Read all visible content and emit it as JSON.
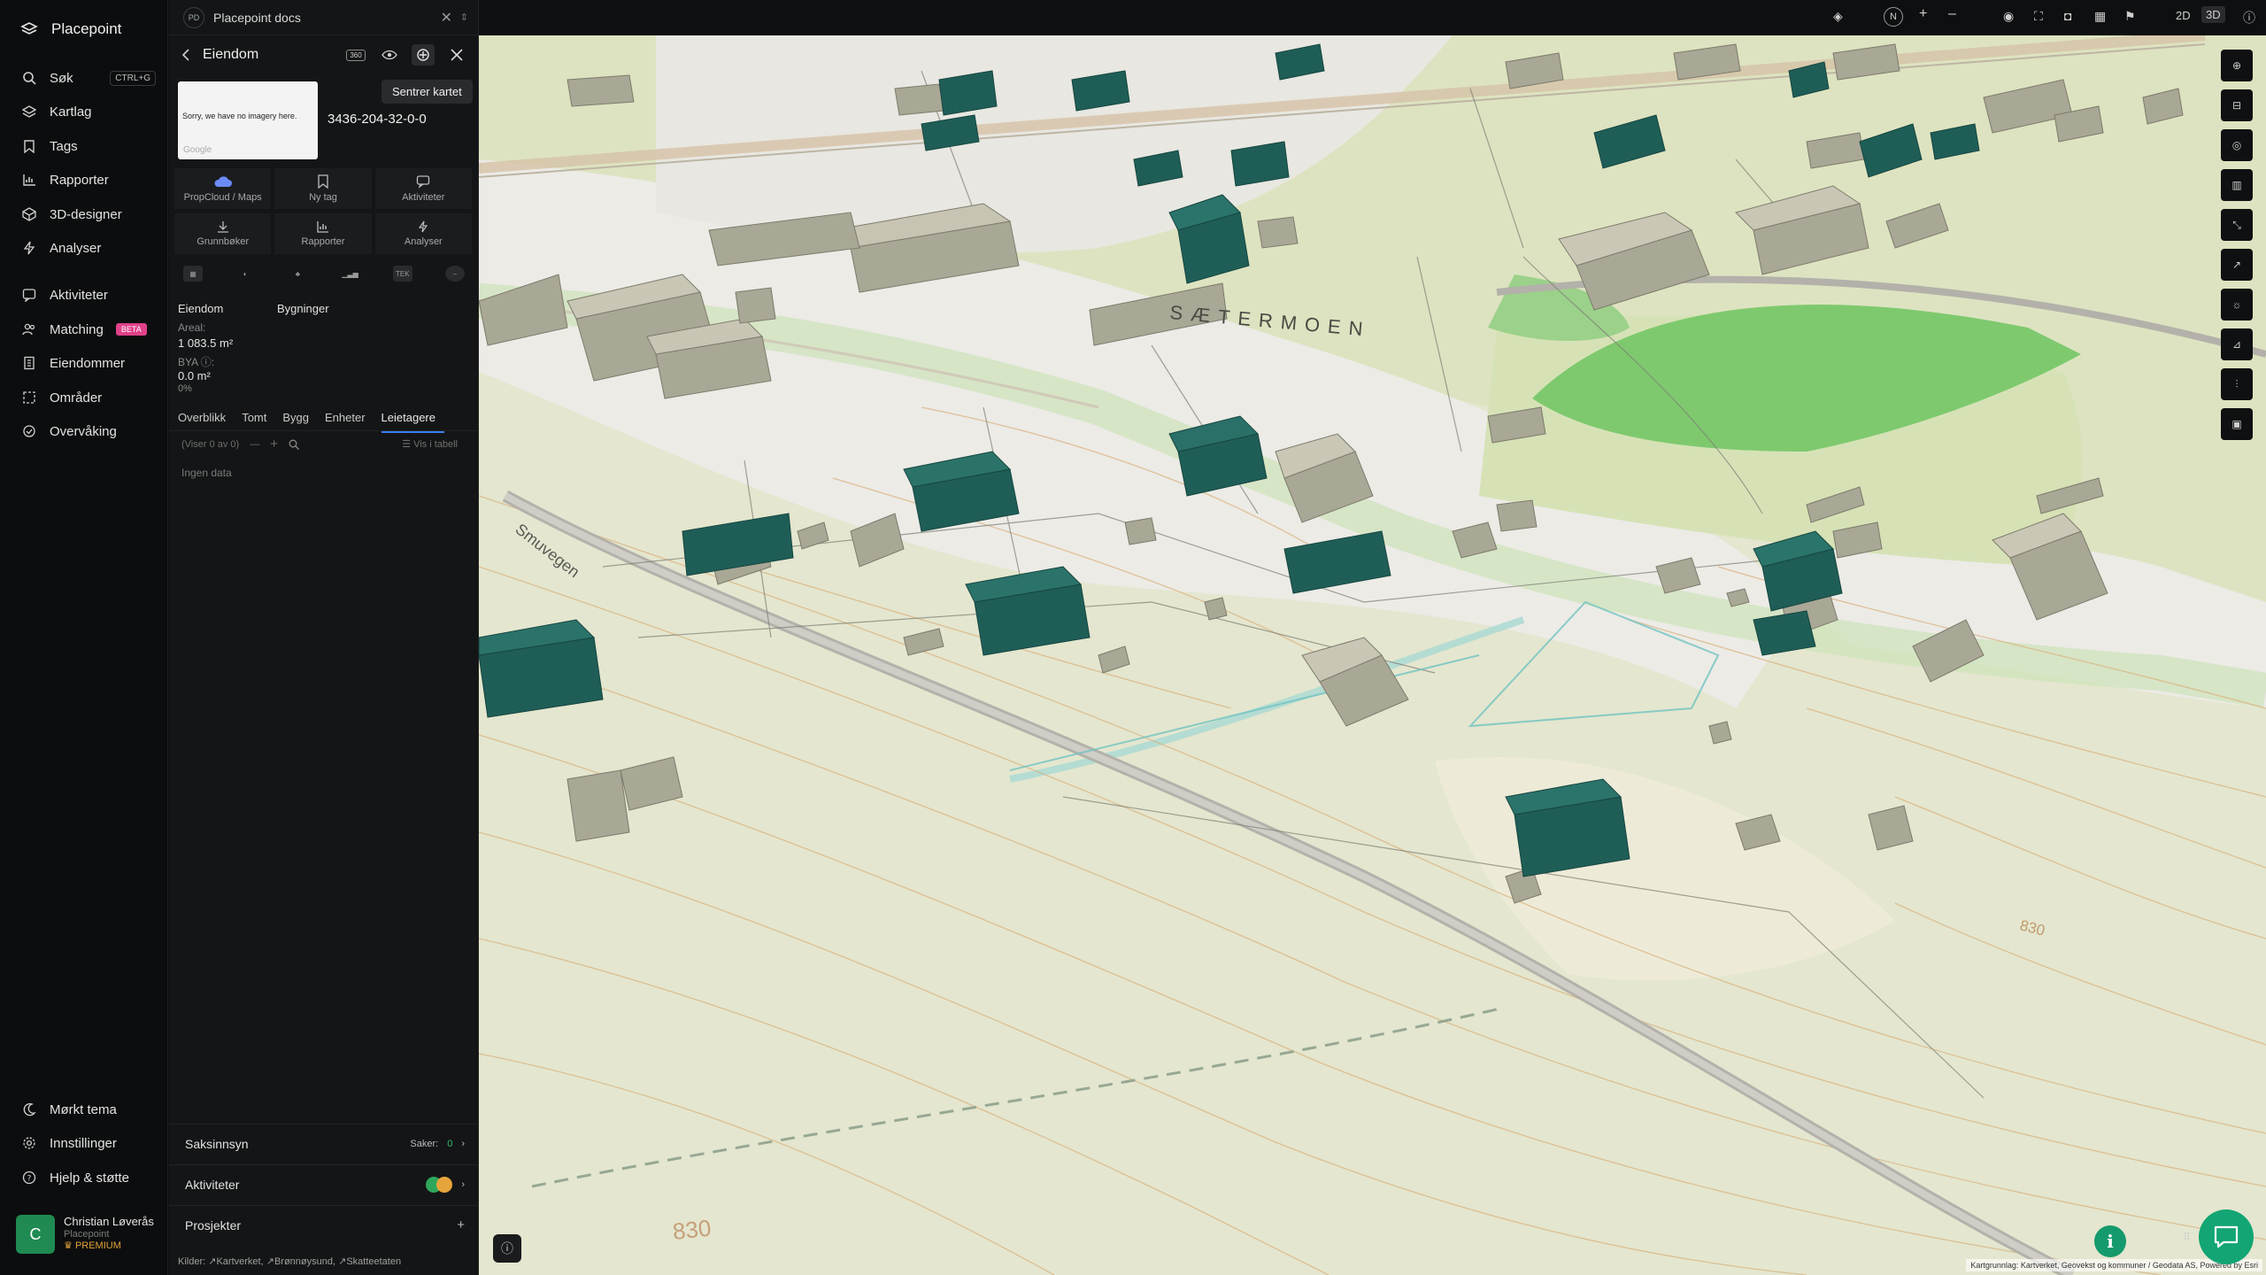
{
  "nav": {
    "brand": "Placepoint",
    "items": [
      {
        "label": "Søk",
        "icon": "search-icon",
        "shortcut": "CTRL+G"
      },
      {
        "label": "Kartlag",
        "icon": "layers-icon"
      },
      {
        "label": "Tags",
        "icon": "bookmark-icon"
      },
      {
        "label": "Rapporter",
        "icon": "chart-icon"
      },
      {
        "label": "3D-designer",
        "icon": "cube-icon"
      },
      {
        "label": "Analyser",
        "icon": "bolt-icon"
      },
      {
        "label": "Aktiviteter",
        "icon": "message-icon"
      },
      {
        "label": "Matching",
        "icon": "people-icon",
        "badge": "BETA"
      },
      {
        "label": "Eiendommer",
        "icon": "building-icon"
      },
      {
        "label": "Områder",
        "icon": "area-icon"
      },
      {
        "label": "Overvåking",
        "icon": "watch-icon"
      }
    ],
    "bottom": [
      {
        "label": "Mørkt tema",
        "icon": "moon-icon"
      },
      {
        "label": "Innstillinger",
        "icon": "gear-icon"
      },
      {
        "label": "Hjelp & støtte",
        "icon": "help-icon"
      }
    ],
    "user": {
      "initial": "C",
      "name": "Christian Løverås",
      "org": "Placepoint",
      "plan": "PREMIUM"
    }
  },
  "panel": {
    "workspace": "Placepoint docs",
    "workspace_abbr": "PD",
    "title": "Eiendom",
    "badge_360": "360",
    "tooltip": "Sentrer kartet",
    "thumb_text": "Sorry, we have no imagery here.",
    "thumb_brand": "Google",
    "property_id": "3436-204-32-0-0",
    "actions": [
      {
        "label": "PropCloud / Maps",
        "icon": "cloud-icon"
      },
      {
        "label": "Ny tag",
        "icon": "tag-icon"
      },
      {
        "label": "Aktiviteter",
        "icon": "message-icon"
      },
      {
        "label": "Grunnbøker",
        "icon": "download-icon"
      },
      {
        "label": "Rapporter",
        "icon": "chart-icon"
      },
      {
        "label": "Analyser",
        "icon": "bolt-icon"
      }
    ],
    "tex": "TEK",
    "col1": "Eiendom",
    "col2": "Bygninger",
    "areal_label": "Areal:",
    "areal_value": "1 083.5 m²",
    "bya_label": "BYA ⓘ:",
    "bya_value": "0.0 m²",
    "bya_pct": "0%",
    "tabs": [
      "Overblikk",
      "Tomt",
      "Bygg",
      "Enheter",
      "Leietagere"
    ],
    "active_tab": 4,
    "viser": "(Viser 0 av 0)",
    "vis_tabell": "Vis i tabell",
    "empty": "Ingen data",
    "sections": {
      "saksinnsyn": "Saksinnsyn",
      "saker_label": "Saker:",
      "saker_count": "0",
      "aktiviteter": "Aktiviteter",
      "prosjekter": "Prosjekter"
    },
    "kilder_label": "Kilder:",
    "kilder": [
      "Kartverket",
      "Brønnøysund",
      "Skatteetaten"
    ]
  },
  "map": {
    "place_label": "SÆTERMOEN",
    "road_label": "Smuvegen",
    "contour_label_1": "830",
    "contour_label_2": "830",
    "mode_2d": "2D",
    "mode_3d": "3D",
    "compass": "N",
    "attribution": "Kartgrunnlag: Kartverket, Geovekst og kommuner / Geodata AS, Powered by Esri",
    "colors": {
      "terrain": "#e3e6cc",
      "cleared": "#ecebe6",
      "building_green": "#1f5e57",
      "building_grey": "#a8a593",
      "field": "#7ec96e",
      "road": "#b3b1aa"
    }
  }
}
